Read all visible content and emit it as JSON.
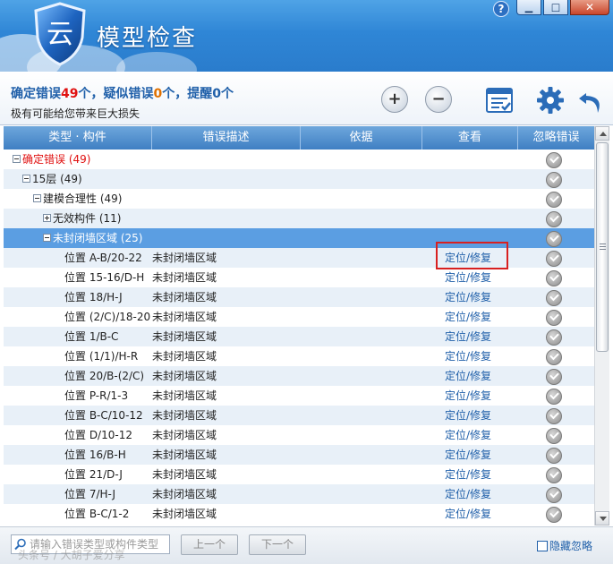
{
  "app": {
    "title": "模型检查"
  },
  "window": {
    "help": "?",
    "minimize": "▁",
    "maximize": "□",
    "close": "✕"
  },
  "summary": {
    "confirmed_label": "确定错误",
    "confirmed_count": "49",
    "confirmed_unit": "个，疑似错误",
    "suspected_count": "0",
    "suspected_unit": "个，提醒",
    "reminder_count": "0",
    "reminder_unit": "个",
    "warning": "极有可能给您带来巨大损失"
  },
  "toolbar": {
    "expand": "+",
    "collapse": "−"
  },
  "columns": {
    "type": "类型 · 构件",
    "desc": "错误描述",
    "basis": "依据",
    "view": "查看",
    "ignore": "忽略错误"
  },
  "tree": [
    {
      "label": "确定错误 (49)",
      "level": 0,
      "expander": "minus",
      "red": true
    },
    {
      "label": "15层 (49)",
      "level": 1,
      "expander": "minus"
    },
    {
      "label": "建模合理性 (49)",
      "level": 2,
      "expander": "minus"
    },
    {
      "label": "无效构件 (11)",
      "level": 3,
      "expander": "plus"
    },
    {
      "label": "未封闭墙区域 (25)",
      "level": 3,
      "expander": "minus",
      "selected": true
    }
  ],
  "items": [
    {
      "position": "位置 A-B/20-22",
      "desc": "未封闭墙区域",
      "action": "定位/修复"
    },
    {
      "position": "位置 15-16/D-H",
      "desc": "未封闭墙区域",
      "action": "定位/修复"
    },
    {
      "position": "位置 18/H-J",
      "desc": "未封闭墙区域",
      "action": "定位/修复"
    },
    {
      "position": "位置 (2/C)/18-20",
      "desc": "未封闭墙区域",
      "action": "定位/修复"
    },
    {
      "position": "位置 1/B-C",
      "desc": "未封闭墙区域",
      "action": "定位/修复"
    },
    {
      "position": "位置 (1/1)/H-R",
      "desc": "未封闭墙区域",
      "action": "定位/修复"
    },
    {
      "position": "位置 20/B-(2/C)",
      "desc": "未封闭墙区域",
      "action": "定位/修复"
    },
    {
      "position": "位置 P-R/1-3",
      "desc": "未封闭墙区域",
      "action": "定位/修复"
    },
    {
      "position": "位置 B-C/10-12",
      "desc": "未封闭墙区域",
      "action": "定位/修复"
    },
    {
      "position": "位置 D/10-12",
      "desc": "未封闭墙区域",
      "action": "定位/修复"
    },
    {
      "position": "位置 16/B-H",
      "desc": "未封闭墙区域",
      "action": "定位/修复"
    },
    {
      "position": "位置 21/D-J",
      "desc": "未封闭墙区域",
      "action": "定位/修复"
    },
    {
      "position": "位置 7/H-J",
      "desc": "未封闭墙区域",
      "action": "定位/修复"
    },
    {
      "position": "位置 B-C/1-2",
      "desc": "未封闭墙区域",
      "action": "定位/修复"
    }
  ],
  "footer": {
    "search_placeholder": "请输入错误类型或构件类型",
    "prev": "上一个",
    "next": "下一个",
    "hide_ignored": "隐藏忽略",
    "watermark": "头条号 / 大胡子爱分享"
  },
  "colors": {
    "accent": "#1f5fa9",
    "error": "#e01010",
    "suspect": "#e07000",
    "selected_row": "#5b9ee2",
    "highlight_box": "#d82020"
  }
}
